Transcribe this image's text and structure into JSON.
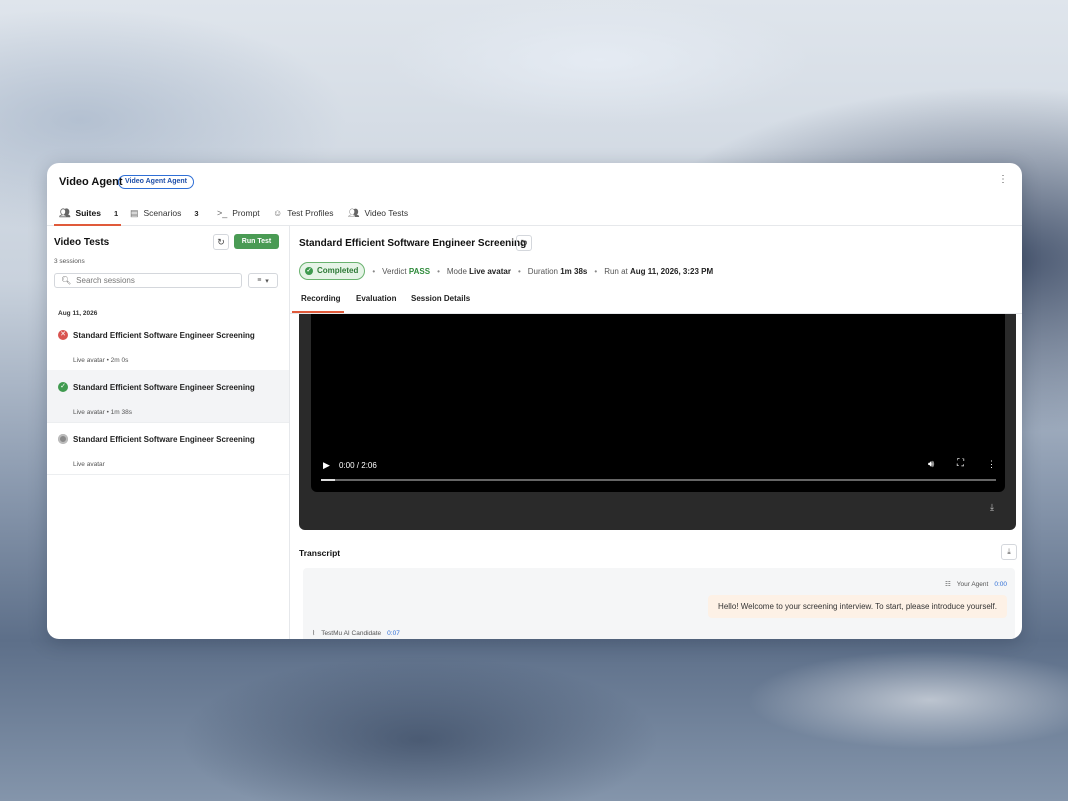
{
  "header": {
    "title": "Video Agent",
    "badge": "Video Agent Agent",
    "menu_icon": "⋮"
  },
  "tabs": [
    {
      "label": "Suites",
      "count": "1",
      "icon": "users-icon"
    },
    {
      "label": "Scenarios",
      "count": "3",
      "icon": "list-icon"
    },
    {
      "label": "Prompt",
      "icon": "terminal-icon"
    },
    {
      "label": "Test Profiles",
      "icon": "user-icon"
    },
    {
      "label": "Video Tests",
      "icon": "users-icon"
    }
  ],
  "sidebar": {
    "title": "Video Tests",
    "run_label": "Run Test",
    "session_count": "3 sessions",
    "search_placeholder": "Search sessions",
    "date_group": "Aug 11, 2026",
    "sessions": [
      {
        "name": "Standard Efficient Software Engineer Screening",
        "meta": "Live avatar • 2m 0s",
        "status": "failed"
      },
      {
        "name": "Standard Efficient Software Engineer Screening",
        "meta": "Live avatar • 1m 38s",
        "status": "passed"
      },
      {
        "name": "Standard Efficient Software Engineer Screening",
        "meta": "Live avatar",
        "status": "pending"
      }
    ]
  },
  "detail": {
    "title": "Standard Efficient Software Engineer Screening",
    "status": "Completed",
    "verdict_label": "Verdict",
    "verdict": "PASS",
    "mode_label": "Mode",
    "mode": "Live avatar",
    "duration_label": "Duration",
    "duration": "1m 38s",
    "run_label": "Run at",
    "run_at": "Aug 11, 2026, 3:23 PM",
    "sub_tabs": [
      "Recording",
      "Evaluation",
      "Session Details"
    ],
    "video": {
      "time": "0:00 / 2:06",
      "progress": 0.02
    },
    "transcript": {
      "title": "Transcript",
      "agent_name": "Your Agent",
      "agent_time": "0:00",
      "agent_message": "Hello! Welcome to your screening interview.  To start, please introduce yourself.",
      "candidate_name": "TestMu AI Candidate",
      "candidate_time": "0:07"
    }
  },
  "colors": {
    "accent": "#e05a3a",
    "pass": "#3f9a4f",
    "fail": "#d9534f",
    "link": "#2f6fd6"
  }
}
